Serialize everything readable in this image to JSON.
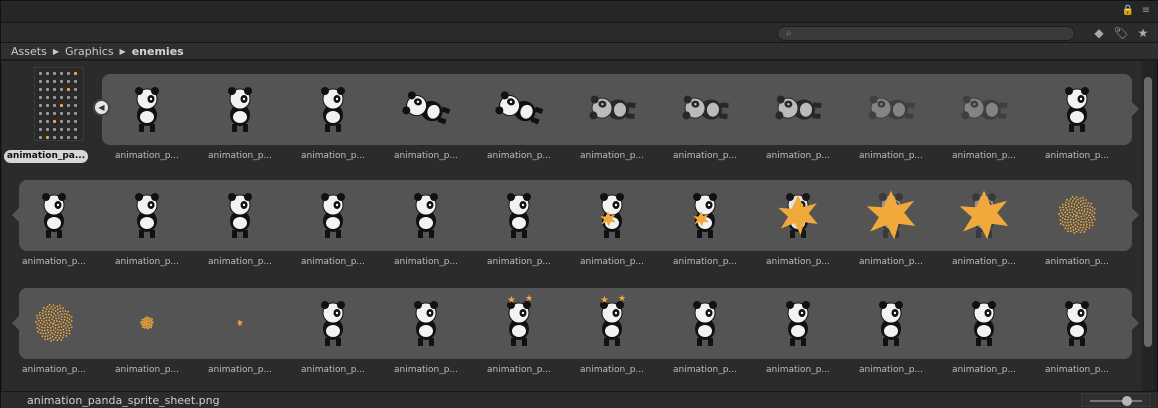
{
  "breadcrumb": [
    "Assets",
    "Graphics",
    "enemies"
  ],
  "search": {
    "placeholder": ""
  },
  "cells": [
    {
      "label": "animation_pa...",
      "selected": true
    },
    {
      "label": "animation_p..."
    },
    {
      "label": "animation_p..."
    },
    {
      "label": "animation_p..."
    },
    {
      "label": "animation_p..."
    },
    {
      "label": "animation_p..."
    },
    {
      "label": "animation_p..."
    },
    {
      "label": "animation_p..."
    },
    {
      "label": "animation_p..."
    },
    {
      "label": "animation_p..."
    },
    {
      "label": "animation_p..."
    },
    {
      "label": "animation_p..."
    },
    {
      "label": "animation_p..."
    },
    {
      "label": "animation_p..."
    },
    {
      "label": "animation_p..."
    },
    {
      "label": "animation_p..."
    },
    {
      "label": "animation_p..."
    },
    {
      "label": "animation_p..."
    },
    {
      "label": "animation_p..."
    },
    {
      "label": "animation_p..."
    },
    {
      "label": "animation_p..."
    },
    {
      "label": "animation_p..."
    },
    {
      "label": "animation_p..."
    },
    {
      "label": "animation_p..."
    },
    {
      "label": "animation_p..."
    },
    {
      "label": "animation_p..."
    },
    {
      "label": "animation_p..."
    },
    {
      "label": "animation_p..."
    },
    {
      "label": "animation_p..."
    },
    {
      "label": "animation_p..."
    },
    {
      "label": "animation_p..."
    },
    {
      "label": "animation_p..."
    },
    {
      "label": "animation_p..."
    },
    {
      "label": "animation_p..."
    },
    {
      "label": "animation_p..."
    },
    {
      "label": "animation_p..."
    }
  ],
  "frames": [
    "sheet",
    "panda",
    "panda",
    "panda",
    "panda-fall",
    "panda-fall",
    "panda-fade",
    "panda-fade",
    "panda-fade",
    "panda-faint",
    "panda-faint",
    "panda",
    "panda",
    "panda",
    "panda",
    "panda",
    "panda",
    "panda",
    "panda-star",
    "panda-star",
    "burst-panda",
    "burst",
    "burst",
    "burst-dots",
    "burst-dots",
    "dots-small",
    "dots-tiny",
    "panda",
    "panda",
    "panda-stars",
    "panda-stars",
    "panda",
    "panda",
    "panda",
    "panda",
    "panda"
  ],
  "footer": {
    "filename": "animation_panda_sprite_sheet.png"
  },
  "colors": {
    "band": "#545454",
    "star": "#f0a93a"
  }
}
